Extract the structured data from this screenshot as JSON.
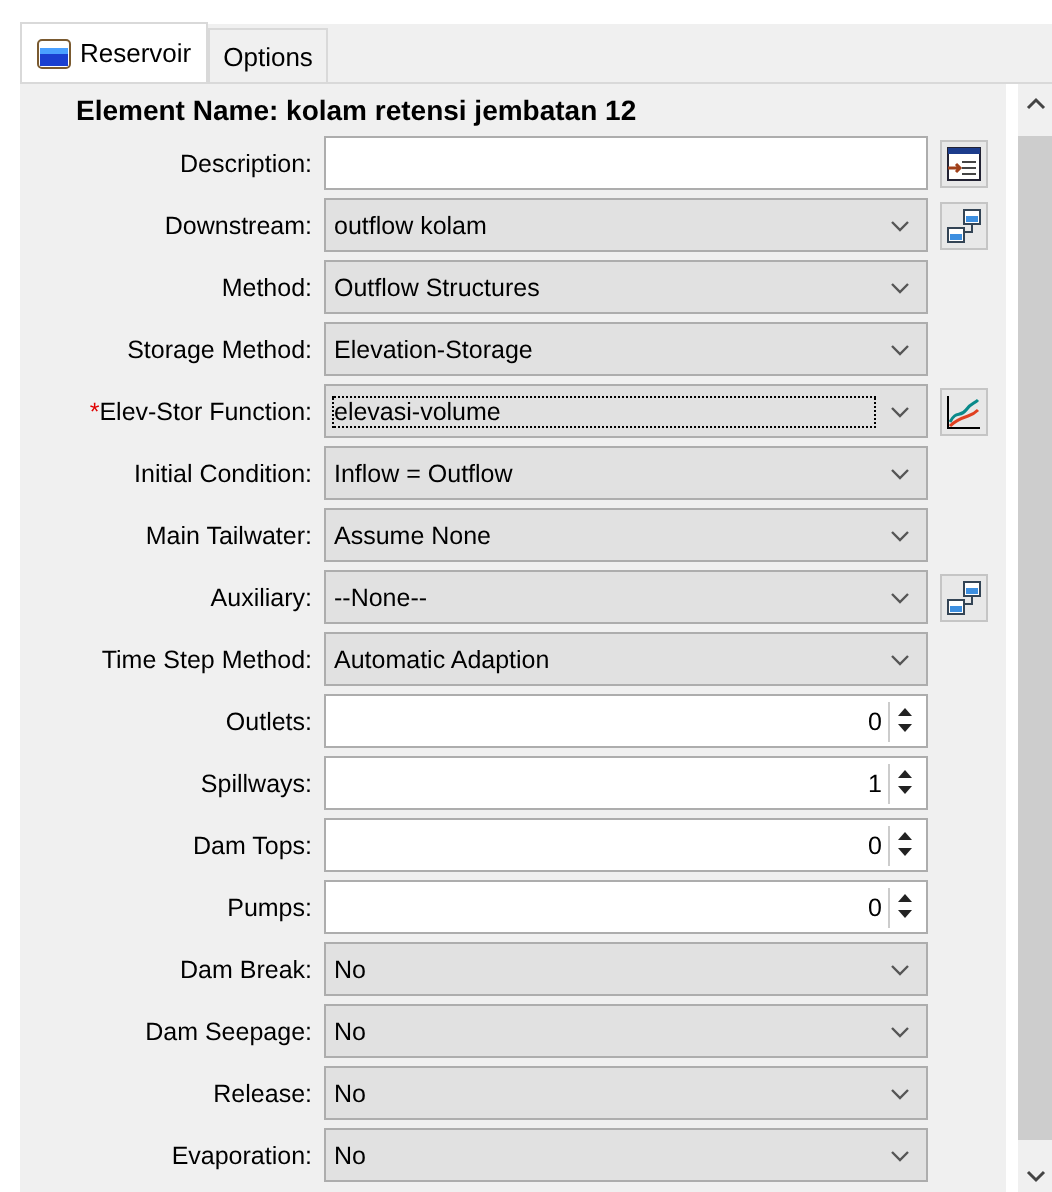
{
  "tabs": [
    {
      "label": "Reservoir",
      "selected": true,
      "icon": true
    },
    {
      "label": "Options",
      "selected": false,
      "icon": false
    }
  ],
  "element_name": "Element Name: kolam retensi jembatan 12",
  "fields": [
    {
      "label": "Description:",
      "kind": "text",
      "button": {
        "kind": "editor"
      }
    },
    {
      "label": "Downstream:",
      "kind": "select",
      "value": "outflow kolam",
      "button": {
        "kind": "reservoir"
      }
    },
    {
      "label": "Method:",
      "kind": "select",
      "value": "Outflow Structures"
    },
    {
      "label": "Storage Method:",
      "kind": "select",
      "value": "Elevation-Storage"
    },
    {
      "label": "Elev-Stor Function:",
      "required_mark": "*",
      "kind": "select",
      "value": "elevasi-volume",
      "focused": true,
      "button": {
        "kind": "chart"
      }
    },
    {
      "label": "Initial Condition:",
      "kind": "select",
      "value": "Inflow = Outflow"
    },
    {
      "label": "Main Tailwater:",
      "kind": "select",
      "value": "Assume None"
    },
    {
      "label": "Auxiliary:",
      "kind": "select",
      "value": "--None--",
      "button": {
        "kind": "reservoir"
      }
    },
    {
      "label": "Time Step Method:",
      "kind": "select",
      "value": "Automatic Adaption"
    },
    {
      "label": "Outlets:",
      "kind": "spinner",
      "value": "0"
    },
    {
      "label": "Spillways:",
      "kind": "spinner",
      "value": "1"
    },
    {
      "label": "Dam Tops:",
      "kind": "spinner",
      "value": "0"
    },
    {
      "label": "Pumps:",
      "kind": "spinner",
      "value": "0"
    },
    {
      "label": "Dam Break:",
      "kind": "select",
      "value": "No"
    },
    {
      "label": "Dam Seepage:",
      "kind": "select",
      "value": "No"
    },
    {
      "label": "Release:",
      "kind": "select",
      "value": "No"
    },
    {
      "label": "Evaporation:",
      "kind": "select",
      "value": "No"
    }
  ]
}
